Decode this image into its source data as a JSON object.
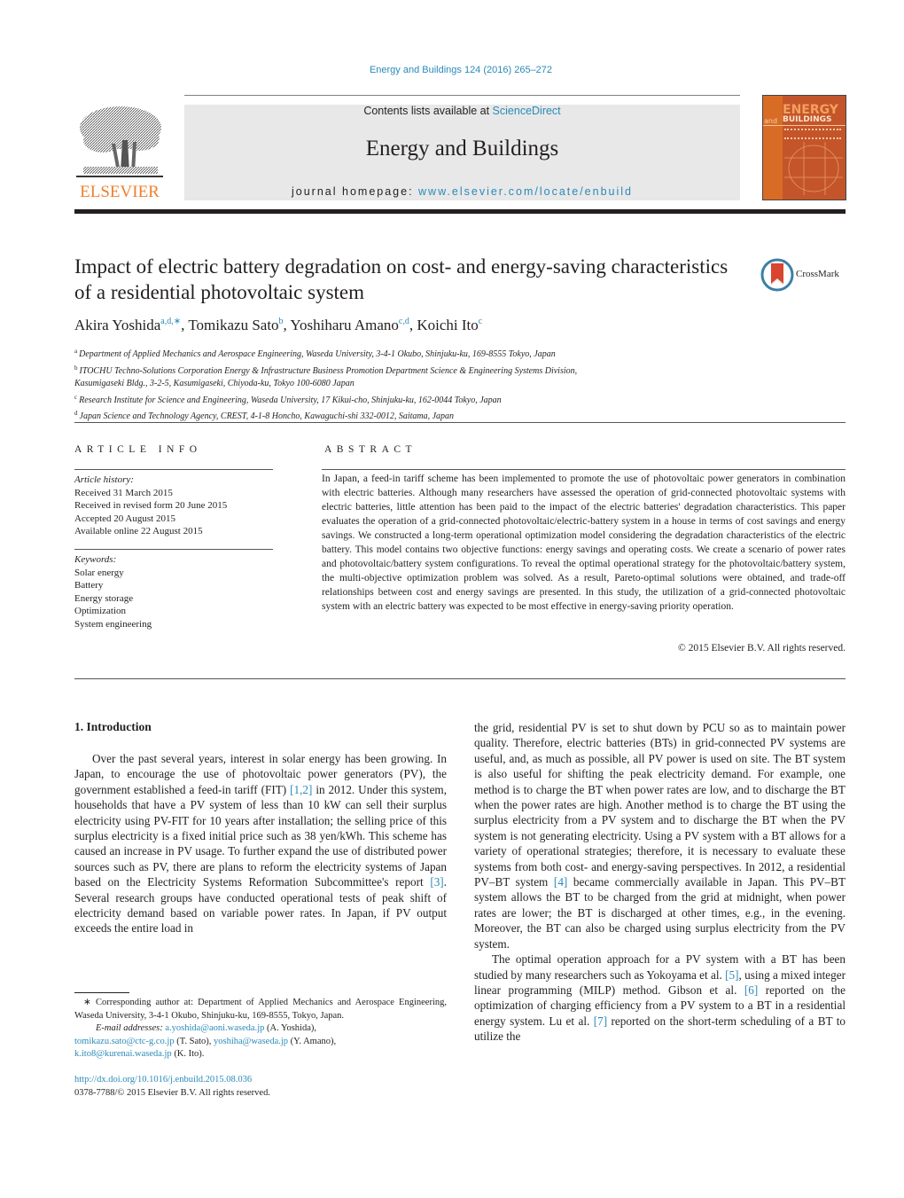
{
  "journal_ref": "Energy and Buildings 124 (2016) 265–272",
  "masthead": {
    "contents_prefix": "Contents lists available at ",
    "contents_link": "ScienceDirect",
    "journal_title": "Energy and Buildings",
    "homepage_prefix": "journal homepage: ",
    "homepage_link": "www.elsevier.com/locate/enbuild"
  },
  "publisher_logo": {
    "wordmark": "ELSEVIER",
    "icon": "elsevier-tree-icon",
    "color": "#f07f2c"
  },
  "cover": {
    "top": "ENERGY",
    "and": "and",
    "bottom": "BUILDINGS"
  },
  "crossmark": {
    "label": "CrossMark",
    "icon": "crossmark-icon"
  },
  "article": {
    "title": "Impact of electric battery degradation on cost- and energy-saving characteristics of a residential photovoltaic system",
    "authors": [
      {
        "name": "Akira Yoshida",
        "sup": "a,d,∗"
      },
      {
        "name": "Tomikazu Sato",
        "sup": "b"
      },
      {
        "name": "Yoshiharu Amano",
        "sup": "c,d"
      },
      {
        "name": "Koichi Ito",
        "sup": "c"
      }
    ],
    "affiliations": [
      {
        "key": "a",
        "text": "Department of Applied Mechanics and Aerospace Engineering, Waseda University, 3-4-1 Okubo, Shinjuku-ku, 169-8555 Tokyo, Japan"
      },
      {
        "key": "b",
        "text": "ITOCHU Techno-Solutions Corporation Energy & Infrastructure Business Promotion Department Science & Engineering Systems Division,"
      },
      {
        "key": "",
        "text": "Kasumigaseki Bldg., 3-2-5, Kasumigaseki, Chiyoda-ku, Tokyo 100-6080 Japan"
      },
      {
        "key": "c",
        "text": "Research Institute for Science and Engineering, Waseda University, 17 Kikui-cho, Shinjuku-ku, 162-0044 Tokyo, Japan"
      },
      {
        "key": "d",
        "text": "Japan Science and Technology Agency, CREST, 4-1-8 Honcho, Kawaguchi-shi 332-0012, Saitama, Japan"
      }
    ]
  },
  "article_info": {
    "heading": "ARTICLE INFO",
    "history_label": "Article history:",
    "history": [
      "Received 31 March 2015",
      "Received in revised form 20 June 2015",
      "Accepted 20 August 2015",
      "Available online 22 August 2015"
    ],
    "keywords_label": "Keywords:",
    "keywords": [
      "Solar energy",
      "Battery",
      "Energy storage",
      "Optimization",
      "System engineering"
    ]
  },
  "abstract": {
    "heading": "ABSTRACT",
    "text": "In Japan, a feed-in tariff scheme has been implemented to promote the use of photovoltaic power generators in combination with electric batteries. Although many researchers have assessed the operation of grid-connected photovoltaic systems with electric batteries, little attention has been paid to the impact of the electric batteries' degradation characteristics. This paper evaluates the operation of a grid-connected photovoltaic/electric-battery system in a house in terms of cost savings and energy savings. We constructed a long-term operational optimization model considering the degradation characteristics of the electric battery. This model contains two objective functions: energy savings and operating costs. We create a scenario of power rates and photovoltaic/battery system configurations. To reveal the optimal operational strategy for the photovoltaic/battery system, the multi-objective optimization problem was solved. As a result, Pareto-optimal solutions were obtained, and trade-off relationships between cost and energy savings are presented. In this study, the utilization of a grid-connected photovoltaic system with an electric battery was expected to be most effective in energy-saving priority operation.",
    "copyright": "© 2015 Elsevier B.V. All rights reserved."
  },
  "introduction": {
    "heading": "1.  Introduction",
    "left_p1": [
      "Over the past several years, interest in solar energy has been growing. In Japan, to encourage the use of photovoltaic power generators (PV), the government established a feed-in tariff (FIT) ",
      "[1,2]",
      " in 2012. Under this system, households that have a PV system of less than 10 kW can sell their surplus electricity using PV-FIT for 10 years after installation; the selling price of this surplus electricity is a fixed initial price such as 38 yen/kWh. This scheme has caused an increase in PV usage. To further expand the use of distributed power sources such as PV, there are plans to reform the electricity systems of Japan based on the Electricity Systems Reformation Subcommittee's report ",
      "[3]",
      ". Several research groups have conducted operational tests of peak shift of electricity demand based on variable power rates. In Japan, if PV output exceeds the entire load in"
    ],
    "right_p1": [
      "the grid, residential PV is set to shut down by PCU so as to maintain power quality. Therefore, electric batteries (BTs) in grid-connected PV systems are useful, and, as much as possible, all PV power is used on site. The BT system is also useful for shifting the peak electricity demand. For example, one method is to charge the BT when power rates are low, and to discharge the BT when the power rates are high. Another method is to charge the BT using the surplus electricity from a PV system and to discharge the BT when the PV system is not generating electricity. Using a PV system with a BT allows for a variety of operational strategies; therefore, it is necessary to evaluate these systems from both cost- and energy-saving perspectives. In 2012, a residential PV–BT system ",
      "[4]",
      " became commercially available in Japan. This PV–BT system allows the BT to be charged from the grid at midnight, when power rates are lower; the BT is discharged at other times, e.g., in the evening. Moreover, the BT can also be charged using surplus electricity from the PV system."
    ],
    "right_p2": [
      "The optimal operation approach for a PV system with a BT has been studied by many researchers such as Yokoyama et al. ",
      "[5]",
      ", using a mixed integer linear programming (MILP) method. Gibson et al. ",
      "[6]",
      " reported on the optimization of charging efficiency from a PV system to a BT in a residential energy system. Lu et al. ",
      "[7]",
      " reported on the short-term scheduling of a BT to utilize the"
    ]
  },
  "footnotes": {
    "corresponding": "∗  Corresponding author at: Department of Applied Mechanics and Aerospace Engineering, Waseda University, 3-4-1 Okubo, Shinjuku-ku, 169-8555, Tokyo, Japan.",
    "email_label": "E-mail addresses: ",
    "emails": [
      {
        "addr": "a.yoshida@aoni.waseda.jp",
        "who": " (A. Yoshida),"
      },
      {
        "addr": "tomikazu.sato@ctc-g.co.jp",
        "who": " (T. Sato), "
      },
      {
        "addr": "yoshiha@waseda.jp",
        "who": " (Y. Amano),"
      },
      {
        "addr": "k.ito8@kurenai.waseda.jp",
        "who": " (K. Ito)."
      }
    ],
    "doi": "http://dx.doi.org/10.1016/j.enbuild.2015.08.036",
    "issn": "0378-7788/© 2015 Elsevier B.V. All rights reserved."
  },
  "colors": {
    "link": "#2a8ab8",
    "elsevier_orange": "#f07f2c",
    "masthead_bg": "#e8e8e8",
    "text": "#231f20"
  }
}
